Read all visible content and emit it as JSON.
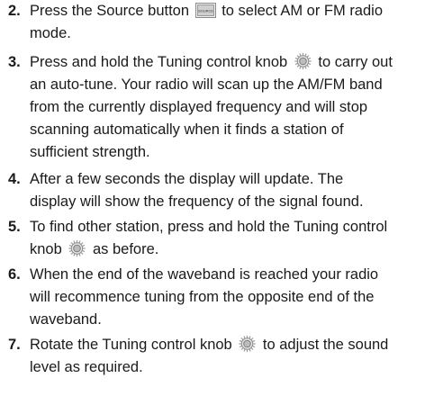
{
  "steps": [
    {
      "number": "2.",
      "lines": [
        [
          "Press the Source button ",
          {
            "icon": "source-button-icon",
            "label": "SOURCE"
          },
          " to select AM or FM radio"
        ],
        [
          "mode."
        ]
      ]
    },
    {
      "number": "3.",
      "lines": [
        [
          "Press and hold the Tuning control knob ",
          {
            "icon": "tuning-knob-icon"
          },
          " to carry out"
        ],
        [
          "an auto-tune. Your radio will scan up the AM/FM band"
        ],
        [
          "from the currently displayed frequency and will stop"
        ],
        [
          "scanning automatically when it finds a station of"
        ],
        [
          "sufficient strength."
        ]
      ]
    },
    {
      "number": "4.",
      "lines": [
        [
          "After a few seconds the display will update. The"
        ],
        [
          "display will show the frequency of the signal found."
        ]
      ]
    },
    {
      "number": "5.",
      "lines": [
        [
          "To find other station, press and hold the Tuning control"
        ],
        [
          "knob ",
          {
            "icon": "tuning-knob-icon"
          },
          " as before."
        ]
      ]
    },
    {
      "number": "6.",
      "lines": [
        [
          "When the end of the waveband is reached your radio"
        ],
        [
          "will recommence tuning from the opposite end of the"
        ],
        [
          "waveband."
        ]
      ]
    },
    {
      "number": "7.",
      "lines": [
        [
          "Rotate the Tuning control knob ",
          {
            "icon": "tuning-knob-icon"
          },
          " to adjust the sound"
        ],
        [
          "level as required."
        ]
      ]
    }
  ]
}
